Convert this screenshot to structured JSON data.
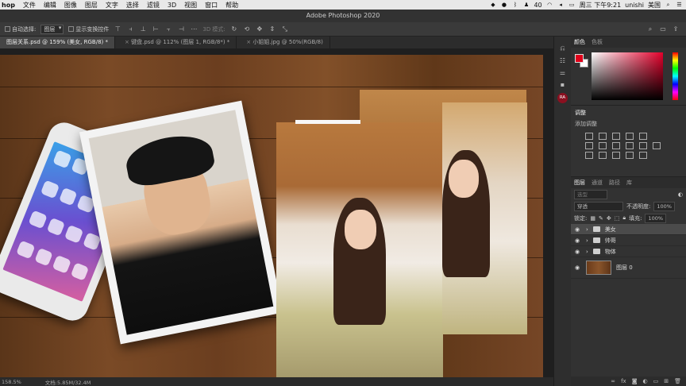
{
  "menubar": {
    "app": "hop",
    "items": [
      "文件",
      "编辑",
      "图像",
      "图层",
      "文字",
      "选择",
      "滤镜",
      "3D",
      "视图",
      "窗口",
      "帮助"
    ],
    "status_right": {
      "battery": "40",
      "clock": "周三 下午9:21",
      "user": "unishi",
      "input_method": "美国"
    }
  },
  "window": {
    "title": "Adobe Photoshop 2020"
  },
  "options": {
    "auto_select_label": "自动选择:",
    "auto_select_value": "图层",
    "show_transform_label": "显示变换控件",
    "mode_3d_label": "3D 模式:"
  },
  "tabs": [
    {
      "label": "图层关系.psd @ 159% (美女, RGB/8) *",
      "active": true
    },
    {
      "label": "键盘.psd @ 112% (图层 1, RGB/8*) *",
      "active": false
    },
    {
      "label": "小姐姐.jpg @ 50%(RGB/8)",
      "active": false
    }
  ],
  "status": {
    "zoom": "158.5%",
    "doc": "文档:5.85M/32.4M"
  },
  "right_tools": {
    "avatar": "RA"
  },
  "panels": {
    "color_tabs": [
      "颜色",
      "色板"
    ],
    "adjust_title": "调整",
    "adjust_add": "添加调整",
    "layers_tabs": [
      "图层",
      "通道",
      "路径",
      "库"
    ],
    "filter_kind": "选型",
    "blend_mode": "穿透",
    "opacity_label": "不透明度:",
    "opacity_value": "100%",
    "lock_label": "锁定:",
    "fill_label": "填充:",
    "fill_value": "100%",
    "layers": [
      {
        "name": "美女",
        "type": "group",
        "selected": true
      },
      {
        "name": "帅哥",
        "type": "group",
        "selected": false
      },
      {
        "name": "物体",
        "type": "group",
        "selected": false
      },
      {
        "name": "图层 0",
        "type": "image",
        "selected": false
      }
    ],
    "footer_icons": [
      "link-icon",
      "fx-icon",
      "mask-icon",
      "adjustment-icon",
      "folder-icon",
      "new-layer-icon",
      "trash-icon"
    ]
  },
  "colors": {
    "foreground": "#e0001a",
    "background": "#ffffff",
    "accent": "#8a1020"
  }
}
